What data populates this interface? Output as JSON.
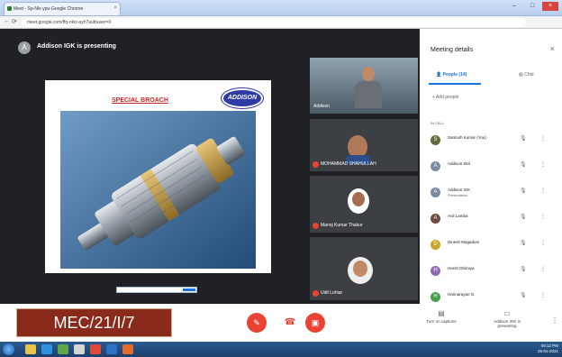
{
  "browser": {
    "tab_title": "Meet - Sp-Nls-ypu-Google Chrome",
    "url": "meet.google.com/ffq-nkiz-ayh?authuser=0"
  },
  "meeting": {
    "presenting_text": "Addison IGK is presenting",
    "presenter_initial": "A"
  },
  "slide": {
    "title": "SPECIAL BROACH",
    "logo_text": "ADDISON"
  },
  "tiles": [
    {
      "name": "Addison"
    },
    {
      "name": "MOHAMMAD SHAHULLAH"
    },
    {
      "name": "Manoj Kumar Thakur"
    },
    {
      "name": "Udit Lohiar"
    }
  ],
  "panel": {
    "title": "Meeting details",
    "tab_people": "People (14)",
    "tab_chat": "Chat",
    "add_people": "Add people",
    "in_call": "IN CALL",
    "participants": [
      {
        "name": "Santosh Kumar (You)",
        "initial": "S",
        "sub": "",
        "avatar_color": "#5f6b3a"
      },
      {
        "name": "Addison Skil",
        "initial": "A",
        "sub": "",
        "avatar_color": "#7a8aa0"
      },
      {
        "name": "Addison IGK",
        "initial": "A",
        "sub": "Presentation",
        "avatar_color": "#7a8aa0"
      },
      {
        "name": "Anil Lamba",
        "initial": "A",
        "sub": "",
        "avatar_color": "#6d4c41"
      },
      {
        "name": "Dinesh Magadum",
        "initial": "D",
        "sub": "",
        "avatar_color": "#c9a227"
      },
      {
        "name": "Harsh Dhimiya",
        "initial": "H",
        "sub": "",
        "avatar_color": "#8e6bb0"
      },
      {
        "name": "Harinarayan G.",
        "initial": "H",
        "sub": "",
        "avatar_color": "#43a047"
      }
    ]
  },
  "bottom": {
    "course_code": "MEC/21/I/7",
    "captions_label": "Turn on captions",
    "presenting_label": "Addison IGK is presenting"
  },
  "taskbar": {
    "time": "09:12 PM",
    "date": "25-01-2021"
  }
}
